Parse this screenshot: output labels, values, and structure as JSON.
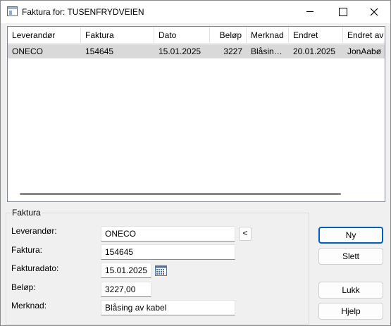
{
  "window": {
    "title": "Faktura for: TUSENFRYDVEIEN"
  },
  "grid": {
    "columns": [
      "Leverandør",
      "Faktura",
      "Dato",
      "Beløp",
      "Merknad",
      "Endret",
      "Endret av"
    ],
    "rows": [
      [
        "ONECO",
        "154645",
        "15.01.2025",
        "3227",
        "Blåsing av kabel",
        "20.01.2025",
        "JonAabø"
      ]
    ]
  },
  "form": {
    "group_label": "Faktura",
    "leverandor_label": "Leverandør:",
    "leverandor_value": "ONECO",
    "faktura_label": "Faktura:",
    "faktura_value": "154645",
    "fakturadato_label": "Fakturadato:",
    "fakturadato_value": "15.01.2025",
    "belop_label": "Beløp:",
    "belop_value": "3227,00",
    "merknad_label": "Merknad:",
    "merknad_value": "Blåsing av kabel",
    "pick_button": "<"
  },
  "buttons": {
    "ny": "Ny",
    "slett": "Slett",
    "lukk": "Lukk",
    "hjelp": "Hjelp"
  },
  "colors": {
    "accent": "#005fb8",
    "row_highlight": "#d9d9d9"
  }
}
